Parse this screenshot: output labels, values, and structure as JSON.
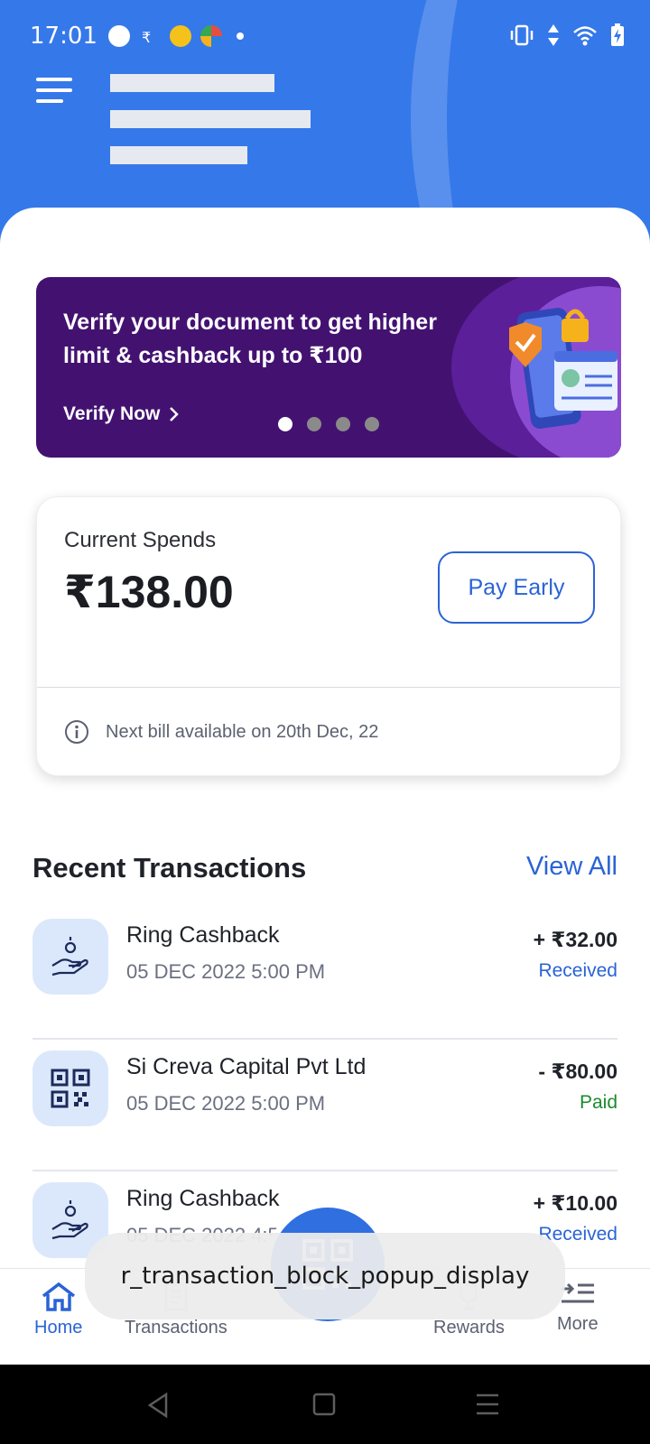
{
  "status_bar": {
    "time": "17:01"
  },
  "promo": {
    "text": "Verify your document to get higher limit & cashback up to ₹100",
    "cta": "Verify Now",
    "dots_total": 4,
    "dots_active": 1
  },
  "spends": {
    "label": "Current Spends",
    "amount": "₹138.00",
    "pay_button": "Pay Early",
    "next_bill": "Next bill available on 20th Dec, 22"
  },
  "transactions": {
    "title": "Recent Transactions",
    "view_all": "View All",
    "items": [
      {
        "name": "Ring Cashback",
        "date": "05 DEC 2022 5:00 PM",
        "amount": "+ ₹32.00",
        "status": "Received",
        "icon": "cashback-hand-icon"
      },
      {
        "name": "Si Creva Capital Pvt Ltd",
        "date": "05 DEC 2022 5:00 PM",
        "amount": "- ₹80.00",
        "status": "Paid",
        "icon": "qr-code-icon"
      },
      {
        "name": "Ring Cashback",
        "date": "05 DEC 2022 4:5",
        "amount": "+ ₹10.00",
        "status": "Received",
        "icon": "cashback-hand-icon"
      }
    ]
  },
  "bottom_nav": {
    "home": "Home",
    "transactions": "Transactions",
    "rewards": "Rewards",
    "more": "More"
  },
  "toast": {
    "text": "r_transaction_block_popup_display"
  },
  "colors": {
    "primary": "#3578ea",
    "accent": "#2a63d6",
    "promo_bg": "#431271",
    "paid": "#1c8a2e"
  }
}
